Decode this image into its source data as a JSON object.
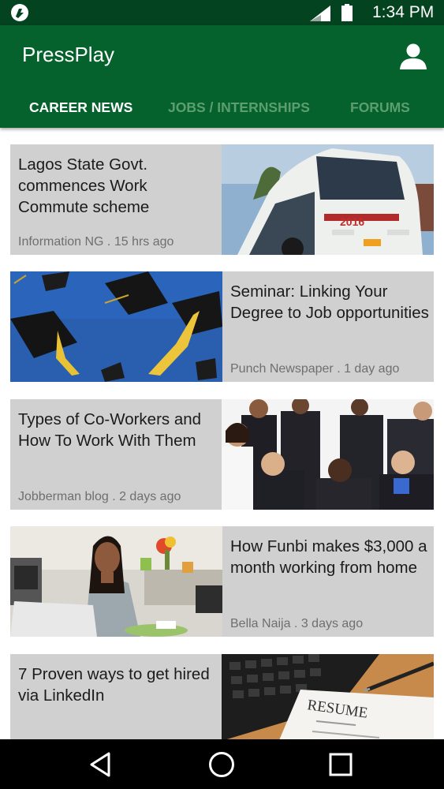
{
  "status_bar": {
    "time": "1:34 PM",
    "icons": [
      "app-notification-icon",
      "signal-icon",
      "battery-icon"
    ]
  },
  "app_bar": {
    "title": "PressPlay",
    "account_icon": "account-icon"
  },
  "tabs": [
    {
      "label": "CAREER NEWS",
      "active": true
    },
    {
      "label": "JOBS / INTERNSHIPS",
      "active": false
    },
    {
      "label": "FORUMS",
      "active": false
    }
  ],
  "articles": [
    {
      "title": "Lagos State Govt. commences Work Commute scheme",
      "meta": "Information NG . 15 hrs ago",
      "image": "bus-photo",
      "image_text": "2016"
    },
    {
      "title": "Seminar: Linking Your Degree to Job opportunities",
      "meta": "Punch Newspaper  . 1 day ago",
      "image": "graduation-caps-photo"
    },
    {
      "title": "Types of Co-Workers and How To Work With Them",
      "meta": "Jobberman blog . 2 days ago",
      "image": "coworkers-group-photo"
    },
    {
      "title": "How Funbi makes $3,000 a month working from home",
      "meta": "Bella Naija . 3 days ago",
      "image": "woman-laptop-photo"
    },
    {
      "title": "7 Proven ways to get hired via LinkedIn",
      "meta": "",
      "image": "resume-keyboard-photo",
      "image_text": "RESUME"
    }
  ],
  "nav_bar": {
    "buttons": [
      "back-icon",
      "home-icon",
      "recents-icon"
    ]
  },
  "colors": {
    "status_bar": "#04431f",
    "app_bar": "#06622d",
    "card_bg": "#d1d0d0",
    "inactive_tab": "#5c9e6e"
  }
}
